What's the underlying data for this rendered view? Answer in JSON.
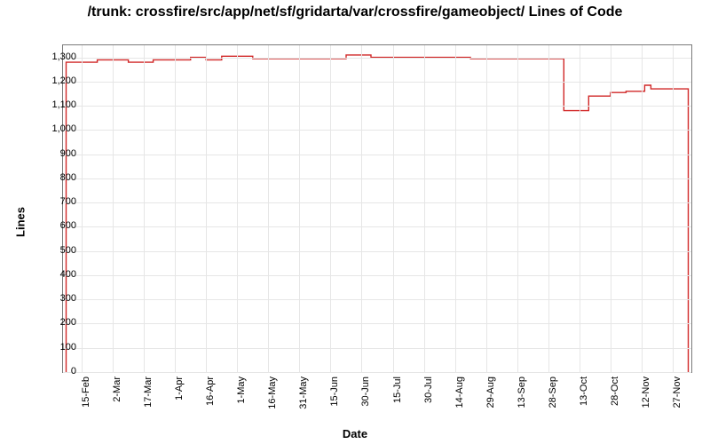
{
  "chart_data": {
    "type": "line",
    "title": "/trunk: crossfire/src/app/net/sf/gridarta/var/crossfire/gameobject/ Lines of Code",
    "xlabel": "Date",
    "ylabel": "Lines",
    "ylim": [
      0,
      1350
    ],
    "y_ticks": [
      0,
      100,
      200,
      300,
      400,
      500,
      600,
      700,
      800,
      900,
      1000,
      1100,
      1200,
      1300
    ],
    "y_tick_labels": [
      "0",
      "100",
      "200",
      "300",
      "400",
      "500",
      "600",
      "700",
      "800",
      "900",
      "1,000",
      "1,100",
      "1,200",
      "1,300"
    ],
    "categories": [
      "15-Feb",
      "2-Mar",
      "17-Mar",
      "1-Apr",
      "16-Apr",
      "1-May",
      "16-May",
      "31-May",
      "15-Jun",
      "30-Jun",
      "15-Jul",
      "30-Jul",
      "14-Aug",
      "29-Aug",
      "13-Sep",
      "28-Sep",
      "13-Oct",
      "28-Oct",
      "12-Nov",
      "27-Nov"
    ],
    "x": [
      0,
      1,
      2,
      3,
      4,
      5,
      6,
      7,
      8,
      9,
      10,
      11,
      12,
      13,
      14,
      15,
      16,
      17,
      18,
      19
    ],
    "series": [
      {
        "name": "Lines of Code",
        "color": "#d12727",
        "points": [
          {
            "x": -0.5,
            "y": 0
          },
          {
            "x": -0.5,
            "y": 1280
          },
          {
            "x": 0.5,
            "y": 1280
          },
          {
            "x": 0.5,
            "y": 1290
          },
          {
            "x": 1.5,
            "y": 1290
          },
          {
            "x": 1.5,
            "y": 1280
          },
          {
            "x": 2.3,
            "y": 1280
          },
          {
            "x": 2.3,
            "y": 1290
          },
          {
            "x": 3.5,
            "y": 1290
          },
          {
            "x": 3.5,
            "y": 1300
          },
          {
            "x": 4.0,
            "y": 1300
          },
          {
            "x": 4.0,
            "y": 1290
          },
          {
            "x": 4.5,
            "y": 1290
          },
          {
            "x": 4.5,
            "y": 1305
          },
          {
            "x": 5.5,
            "y": 1305
          },
          {
            "x": 5.5,
            "y": 1295
          },
          {
            "x": 8.5,
            "y": 1295
          },
          {
            "x": 8.5,
            "y": 1310
          },
          {
            "x": 9.3,
            "y": 1310
          },
          {
            "x": 9.3,
            "y": 1300
          },
          {
            "x": 12.5,
            "y": 1300
          },
          {
            "x": 12.5,
            "y": 1295
          },
          {
            "x": 15.5,
            "y": 1295
          },
          {
            "x": 15.5,
            "y": 1080
          },
          {
            "x": 16.3,
            "y": 1080
          },
          {
            "x": 16.3,
            "y": 1140
          },
          {
            "x": 17.0,
            "y": 1140
          },
          {
            "x": 17.0,
            "y": 1155
          },
          {
            "x": 17.5,
            "y": 1155
          },
          {
            "x": 17.5,
            "y": 1160
          },
          {
            "x": 18.1,
            "y": 1160
          },
          {
            "x": 18.1,
            "y": 1185
          },
          {
            "x": 18.3,
            "y": 1185
          },
          {
            "x": 18.3,
            "y": 1170
          },
          {
            "x": 19.5,
            "y": 1170
          },
          {
            "x": 19.5,
            "y": 0
          }
        ]
      }
    ]
  }
}
